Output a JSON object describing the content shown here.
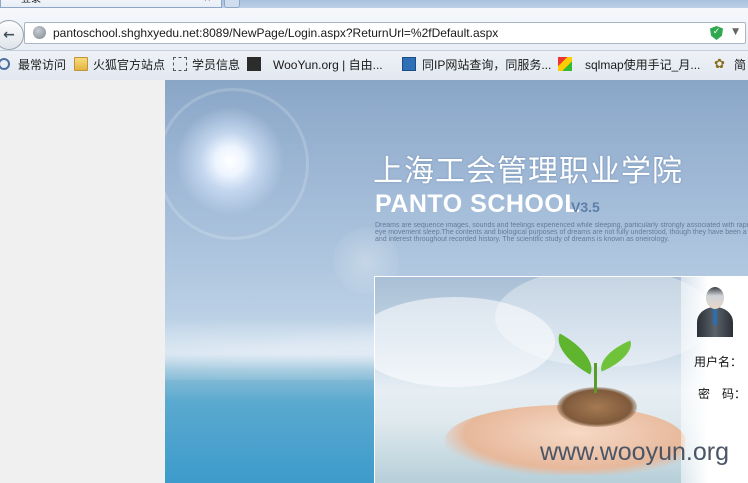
{
  "browser": {
    "tab_title": "登录",
    "tab_close": "×",
    "url": "pantoschool.shghxyedu.net:8089/NewPage/Login.aspx?ReturnUrl=%2fDefault.aspx",
    "back_glyph": "←",
    "shield_glyph": "✓",
    "dropdown_glyph": "▼"
  },
  "bookmarks": [
    {
      "label": "最常访问",
      "icon": "search-icon"
    },
    {
      "label": "火狐官方站点",
      "icon": "folder-icon"
    },
    {
      "label": "学员信息",
      "icon": "page-icon"
    },
    {
      "label": "WooYun.org | 自由...",
      "icon": "wooyun-icon"
    },
    {
      "label": "同IP网站查询，同服务...",
      "icon": "chart-icon"
    },
    {
      "label": "sqlmap使用手记_月...",
      "icon": "colorful-icon"
    },
    {
      "label": "简",
      "icon": "flower-icon"
    }
  ],
  "page": {
    "title_cn": "上海工会管理职业学院",
    "title_en": "PANTO SCHOOL",
    "version": "V3.5",
    "tagline_1": "Dreams are sequence images, sounds and feelings experienced while sleeping, particularly strongly associated with rapid",
    "tagline_2": "eye movement sleep.The contents and biological purposes of dreams are not fully understood, though they have been a topic of speculation",
    "tagline_3": "and interest throughout recorded history. The scientific study of dreams is known as oneirology.",
    "login": {
      "username_label": "用户名：",
      "password_label": "密　码："
    },
    "watermark": "www.wooyun.org"
  },
  "colors": {
    "sky_top": "#8aa6c7",
    "sea": "#3d9bcb",
    "version_text": "#5d7ea8",
    "sprout": "#5fb52e"
  }
}
